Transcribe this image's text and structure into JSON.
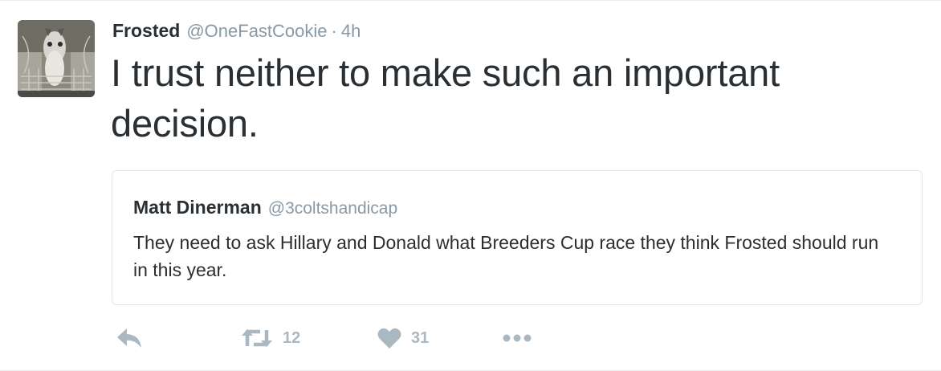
{
  "tweet": {
    "author_name": "Frosted",
    "author_handle": "@OneFastCookie",
    "separator": "·",
    "time": "4h",
    "text": "I trust neither to make such an important decision."
  },
  "quoted_tweet": {
    "author_name": "Matt Dinerman",
    "author_handle": "@3coltshandicap",
    "text": "They need to ask Hillary and Donald what Breeders Cup race they think Frosted should run in this year."
  },
  "actions": {
    "reply_icon": "reply-icon",
    "retweet_icon": "retweet-icon",
    "retweet_count": "12",
    "like_icon": "heart-icon",
    "like_count": "31",
    "more_icon": "more-dots-icon"
  },
  "colors": {
    "text": "#292f33",
    "secondary": "#8899a6",
    "action_icon": "#aab8c2",
    "border": "#e1e8ed"
  }
}
